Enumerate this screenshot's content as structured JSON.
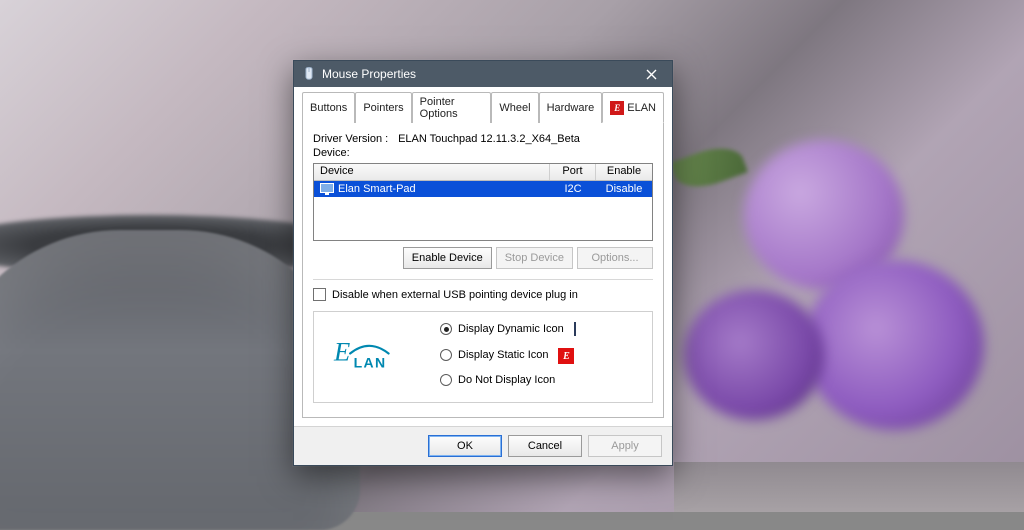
{
  "dialog": {
    "title": "Mouse Properties"
  },
  "tabs": {
    "items": [
      {
        "label": "Buttons"
      },
      {
        "label": "Pointers"
      },
      {
        "label": "Pointer Options"
      },
      {
        "label": "Wheel"
      },
      {
        "label": "Hardware"
      },
      {
        "label": "ELAN"
      }
    ],
    "active_index": 5
  },
  "driver": {
    "label": "Driver Version :",
    "value": "ELAN Touchpad 12.11.3.2_X64_Beta"
  },
  "device_label": "Device:",
  "listview": {
    "columns": [
      "Device",
      "Port",
      "Enable"
    ],
    "rows": [
      {
        "device": "Elan Smart-Pad",
        "port": "I2C",
        "enable": "Disable",
        "selected": true
      }
    ]
  },
  "buttons": {
    "enable": "Enable Device",
    "stop": "Stop Device",
    "options": "Options..."
  },
  "checkbox": {
    "label": "Disable when external USB pointing device plug in",
    "checked": false
  },
  "radios": {
    "items": [
      {
        "label": "Display Dynamic Icon",
        "icon": "monitor"
      },
      {
        "label": "Display Static Icon",
        "icon": "elan"
      },
      {
        "label": "Do Not Display Icon",
        "icon": "none"
      }
    ],
    "selected_index": 0
  },
  "footer": {
    "ok": "OK",
    "cancel": "Cancel",
    "apply": "Apply"
  }
}
